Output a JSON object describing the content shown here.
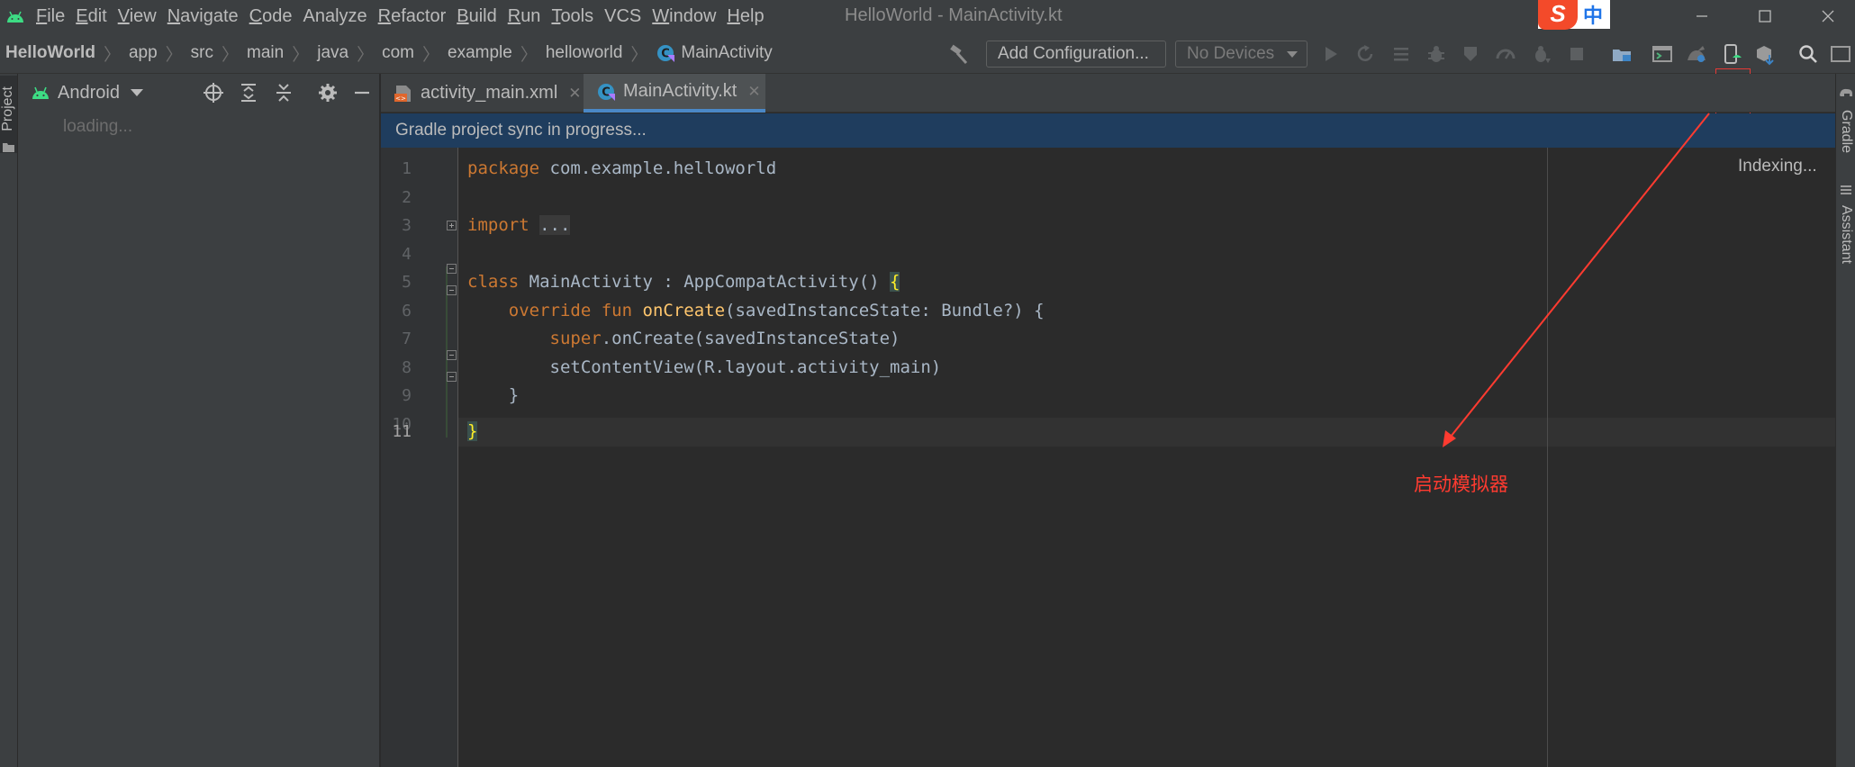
{
  "menubar": {
    "items": [
      {
        "mnemonic": "F",
        "rest": "ile"
      },
      {
        "mnemonic": "E",
        "rest": "dit"
      },
      {
        "mnemonic": "V",
        "rest": "iew"
      },
      {
        "mnemonic": "N",
        "rest": "avigate"
      },
      {
        "mnemonic": "C",
        "rest": "ode"
      },
      {
        "mnemonic": "",
        "rest": "Analyze"
      },
      {
        "mnemonic": "R",
        "rest": "efactor"
      },
      {
        "mnemonic": "B",
        "rest": "uild"
      },
      {
        "mnemonic": "R",
        "rest": "un"
      },
      {
        "mnemonic": "T",
        "rest": "ools"
      },
      {
        "mnemonic": "",
        "rest": "VCS"
      },
      {
        "mnemonic": "W",
        "rest": "indow"
      },
      {
        "mnemonic": "H",
        "rest": "elp"
      }
    ],
    "window_title": "HelloWorld - MainActivity.kt",
    "ime": {
      "logo": "S",
      "lang": "中"
    }
  },
  "breadcrumb": [
    "HelloWorld",
    "app",
    "src",
    "main",
    "java",
    "com",
    "example",
    "helloworld",
    "MainActivity"
  ],
  "toolbar": {
    "add_configuration": "Add Configuration...",
    "devices": "No Devices",
    "icons": [
      "build-hammer-icon",
      "run-icon",
      "rerun-icon",
      "apply-changes-icon",
      "debug-icon",
      "profile-icon",
      "attach-debugger-icon",
      "stop-icon",
      "sync-project-icon",
      "project-structure-icon",
      "sdk-manager-icon",
      "avd-manager-icon",
      "device-manager-icon",
      "search-icon",
      "settings-icon"
    ]
  },
  "left_stripe": {
    "project_tab": "Project"
  },
  "project_panel": {
    "view": "Android",
    "loading": "loading..."
  },
  "tabs": [
    {
      "label": "activity_main.xml",
      "active": false
    },
    {
      "label": "MainActivity.kt",
      "active": true
    }
  ],
  "banner": "Gradle project sync in progress...",
  "editor": {
    "indexing": "Indexing...",
    "current_line": 11,
    "lines": [
      {
        "n": "1"
      },
      {
        "n": "2"
      },
      {
        "n": "3"
      },
      {
        "n": "4"
      },
      {
        "n": "5"
      },
      {
        "n": "6"
      },
      {
        "n": "7"
      },
      {
        "n": "8"
      },
      {
        "n": "9"
      },
      {
        "n": "10"
      },
      {
        "n": "11"
      }
    ],
    "code": {
      "l1_kw": "package",
      "l1_rest": " com.example.helloworld",
      "l3_kw": "import",
      "l3_folded": "...",
      "l6_kw": "class",
      "l6_rest": " MainActivity : AppCompatActivity() ",
      "l6_brace": "{",
      "l7_kw": "override fun",
      "l7_fn": "onCreate",
      "l7_rest": "(savedInstanceState: Bundle?) {",
      "l8_kw": "super",
      "l8_rest": ".onCreate(savedInstanceState)",
      "l9_rest": "setContentView(R.layout.activity_main)",
      "l10_rest": "}",
      "l11_brace": "}"
    }
  },
  "annotation": {
    "label": "启动模拟器",
    "color": "#ff3b30"
  },
  "right_stripe": {
    "gradle": "Gradle",
    "assistant": "Assistant"
  },
  "colors": {
    "accent_tab": "#4a88c7",
    "banner": "#1f3d5e",
    "keyword": "#cc7832",
    "function": "#ffc66d"
  }
}
